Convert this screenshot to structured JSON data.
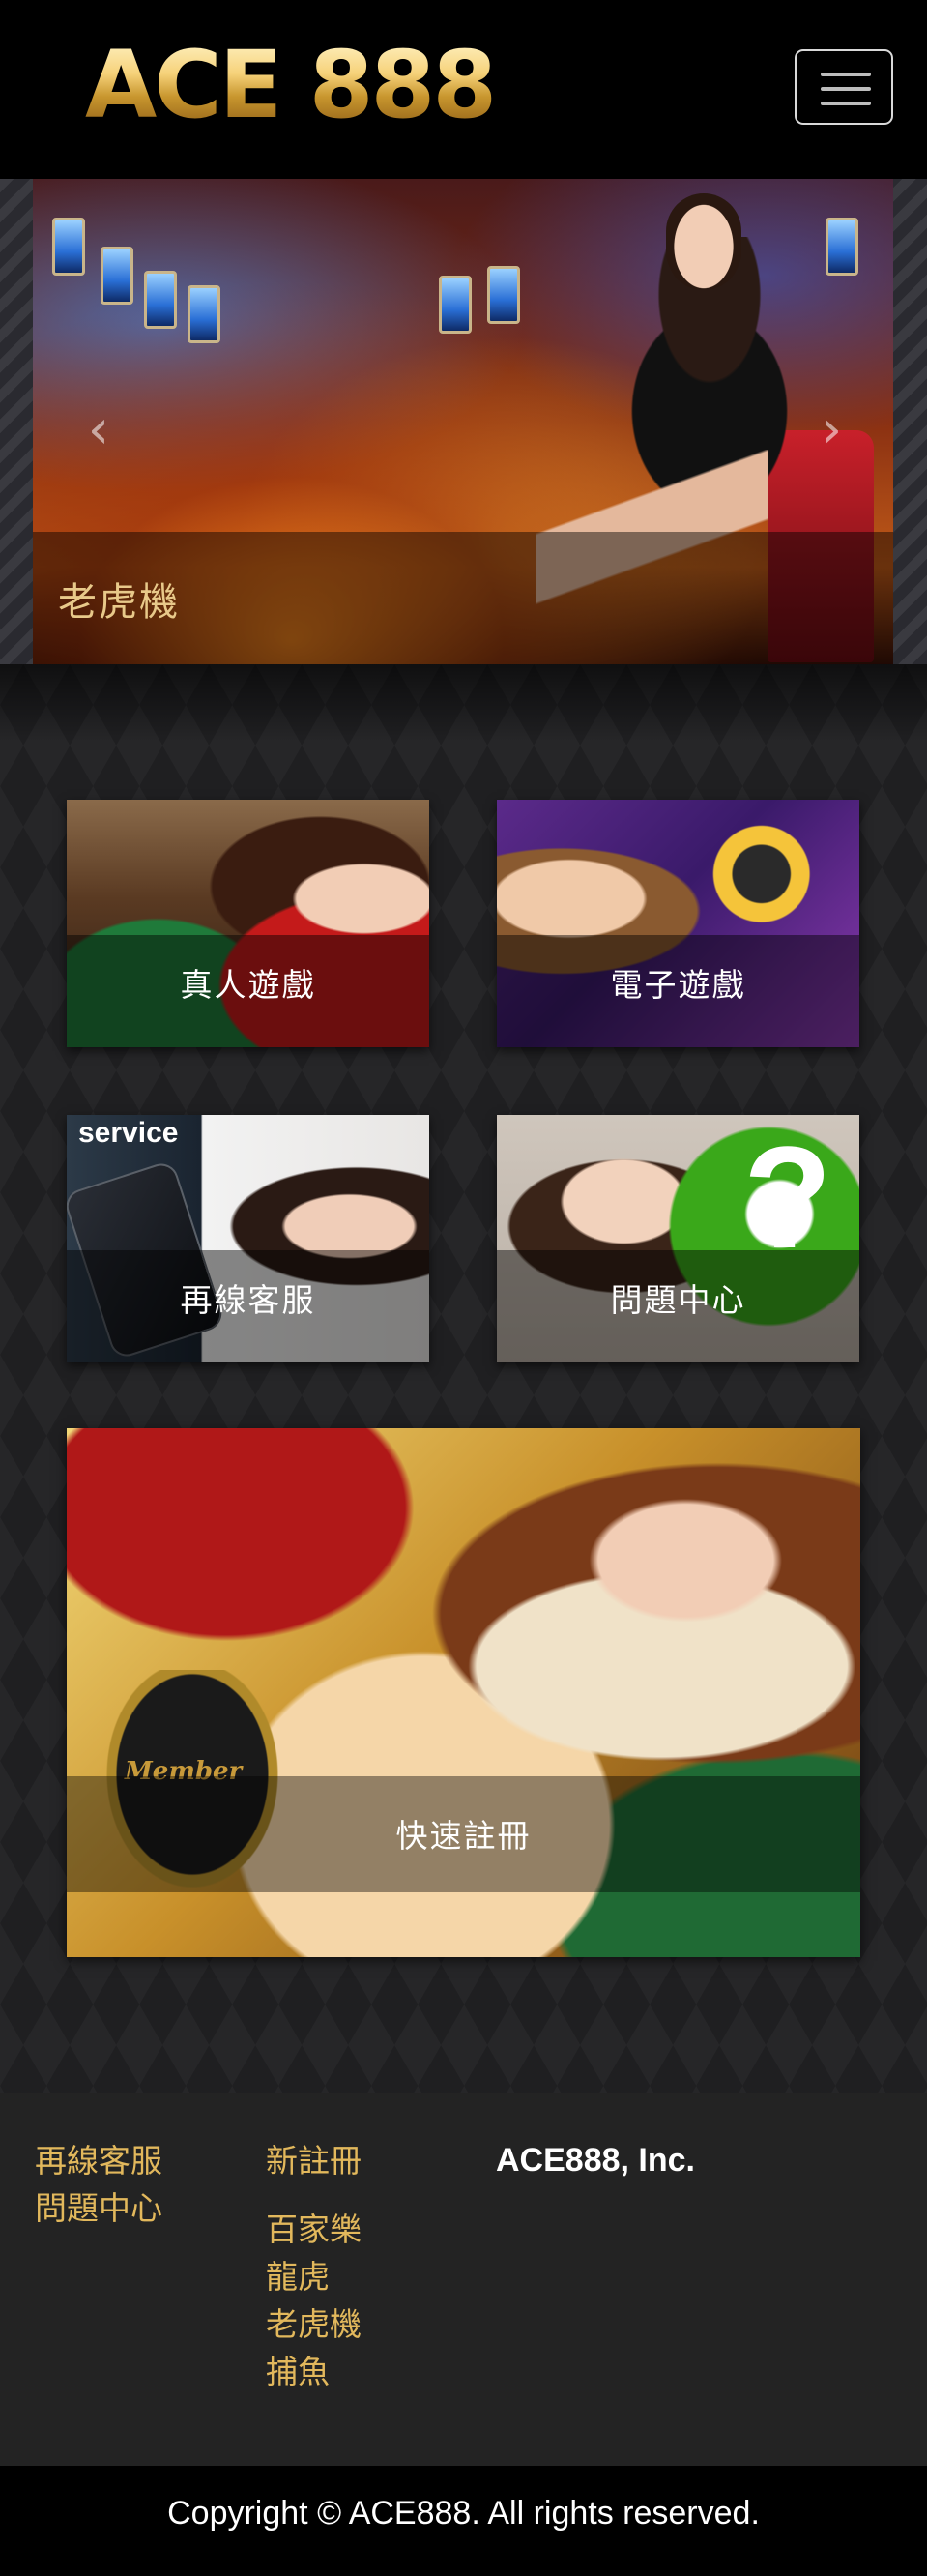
{
  "header": {
    "logo_text": "ACE 888",
    "menu_icon": "hamburger-menu-icon"
  },
  "hero": {
    "caption": "老虎機",
    "prev_icon": "chevron-left-icon",
    "next_icon": "chevron-right-icon"
  },
  "tiles": {
    "live": "真人遊戲",
    "slot": "電子遊戲",
    "service": "再線客服",
    "service_badge": "service",
    "faq": "問題中心",
    "register": "快速註冊",
    "register_badge": "Member"
  },
  "footer": {
    "col1": [
      "再線客服",
      "問題中心"
    ],
    "col2_top": "新註冊",
    "col2_games": [
      "百家樂",
      "龍虎",
      "老虎機",
      "捕魚"
    ],
    "brand": "ACE888, Inc."
  },
  "copyright": "Copyright © ACE888. All rights reserved.",
  "colors": {
    "gold_text": "#e2b85c",
    "footer_bg": "#232323",
    "header_bg": "#000000"
  }
}
